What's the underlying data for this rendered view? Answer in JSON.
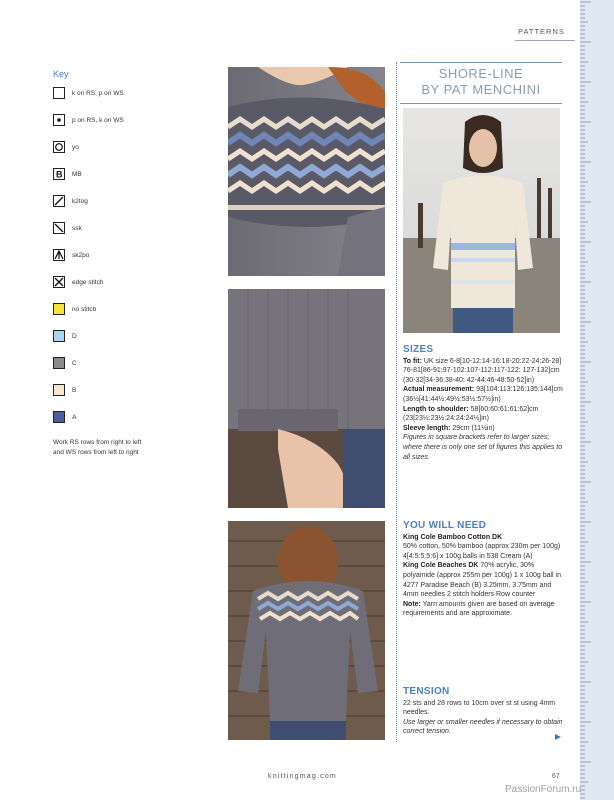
{
  "header": {
    "section": "PATTERNS"
  },
  "key": {
    "title": "Key",
    "items": [
      {
        "label": "k on RS, p on WS",
        "symbol": "blank"
      },
      {
        "label": "p on RS, k on WS",
        "symbol": "dot"
      },
      {
        "label": "yo",
        "symbol": "circle"
      },
      {
        "label": "MB",
        "symbol": "letter-b"
      },
      {
        "label": "k2tog",
        "symbol": "slash-right"
      },
      {
        "label": "ssk",
        "symbol": "slash-left"
      },
      {
        "label": "sk2po",
        "symbol": "arrow-up"
      },
      {
        "label": "edge stitch",
        "symbol": "cross"
      },
      {
        "label": "no stitch",
        "color": "#f4e53a"
      },
      {
        "label": "D",
        "color": "#a9d6ef"
      },
      {
        "label": "C",
        "color": "#8c8c8c"
      },
      {
        "label": "B",
        "color": "#f6e7d2"
      },
      {
        "label": "A",
        "color": "#4b5d9c"
      }
    ],
    "note_line1": "Work RS rows from right to left",
    "note_line2": "and WS rows from left to right"
  },
  "title": {
    "line1": "SHORE-LINE",
    "line2": "BY PAT MENCHINI"
  },
  "sizes": {
    "heading": "SIZES",
    "to_fit_label": "To fit:",
    "to_fit_value": " UK size 6-8[10-12:14-16:18-20:22-24:26-28] 76-81[86-91:97-102:107-112:117-122: 127-132]cm (30-32[34-36:38-40: 42-44:46-48:50-52]in)",
    "actual_label": "Actual measurement:",
    "actual_value": " 93[104:113:126:135:144]cm (36½[41:44½:49½:53½:57½]in)",
    "shoulder_label": "Length to shoulder:",
    "shoulder_value": " 58[60:60:61:61:62]cm (23[23½:23½:24:24:24½]in)",
    "sleeve_label": "Sleeve length:",
    "sleeve_value": " 29cm (11½in)",
    "note": "Figures in square brackets refer to larger sizes; where there is only one set of figures this applies to all sizes."
  },
  "you_will_need": {
    "heading": "YOU WILL NEED",
    "yarn1_name": "King Cole Bamboo Cotton DK",
    "yarn1_desc": "50% cotton, 50% bamboo (approx 230m per 100g) 4[4:5:5:5:6] x 100g balls in 538 Cream (A)",
    "yarn2_name": "King Cole Beaches DK",
    "yarn2_desc": " 70% acrylic, 30% polyamide (approx 255m per 100g) 1 x 100g ball in 4277 Paradise Beach (B) 3.25mm, 3.75mm and 4mm needles 2 stitch holders Row counter",
    "note_label": "Note:",
    "note_value": " Yarn amounts given are based on average requirements and are approximate."
  },
  "tension": {
    "heading": "TENSION",
    "text": "22 sts and 28 rows to 10cm over st st using 4mm needles.",
    "note": "Use larger or smaller needles if necessary to obtain correct tension."
  },
  "footer": {
    "site": "knittingmag.com",
    "page": "67",
    "watermark": "PassionForum.ru"
  }
}
